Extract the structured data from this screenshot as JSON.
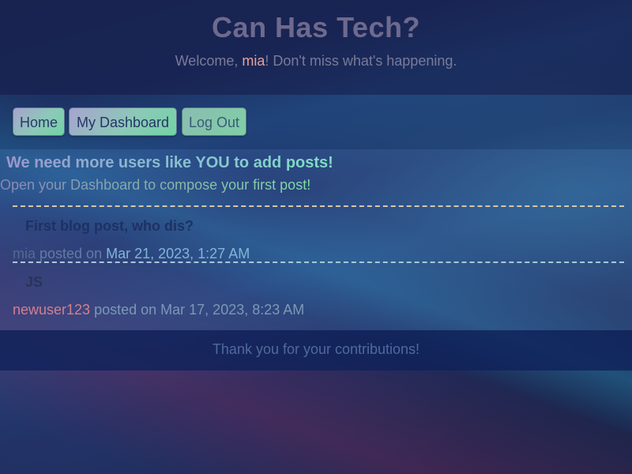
{
  "header": {
    "title": "Can Has Tech?",
    "welcome_prefix": "Welcome, ",
    "username": "mia",
    "welcome_suffix": "! Don't miss what's happening."
  },
  "nav": {
    "home": "Home",
    "dashboard": "My Dashboard",
    "logout": "Log Out"
  },
  "main": {
    "cta_title": "We need more users like YOU to add posts!",
    "cta_subtitle": "Open your Dashboard to compose your first post!",
    "posts": [
      {
        "title": "First blog post, who dis?",
        "author": "mia",
        "posted_on": " posted on ",
        "date": "Mar 21, 2023, 1:27 AM"
      },
      {
        "title": "JS",
        "author": "newuser123",
        "posted_on": " posted on ",
        "date": "Mar 17, 2023, 8:23 AM"
      }
    ]
  },
  "footer": {
    "text": "Thank you for your contributions!"
  }
}
